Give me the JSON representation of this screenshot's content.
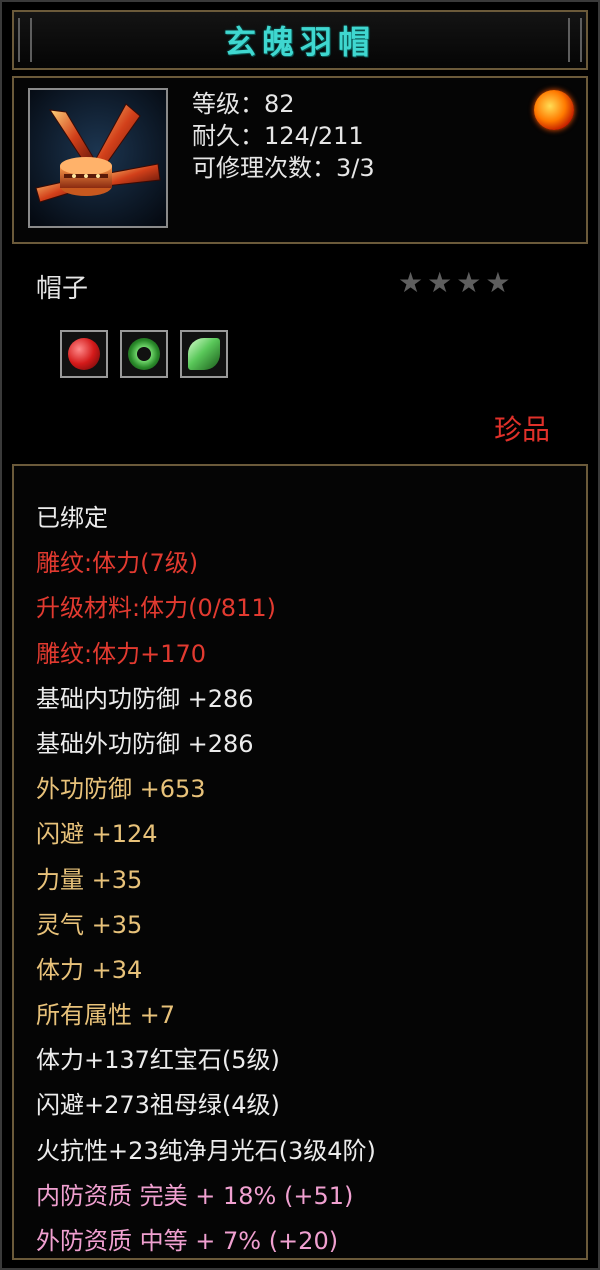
{
  "item": {
    "name": "玄魄羽帽",
    "stats": {
      "level": "等级：82",
      "durability": "耐久：124/211",
      "repairs": "可修理次数：3/3"
    },
    "type": "帽子",
    "stars": {
      "filled": 0,
      "total": 4
    },
    "quality": "珍品",
    "gems": [
      "red-gem-icon",
      "green-ring-gem-icon",
      "green-leaf-gem-icon"
    ]
  },
  "attributes": [
    {
      "text": "已绑定",
      "color": "white"
    },
    {
      "text": "雕纹:体力(7级)",
      "color": "red"
    },
    {
      "text": "升级材料:体力(0/811)",
      "color": "red"
    },
    {
      "text": "雕纹:体力+170",
      "color": "red"
    },
    {
      "text": "基础内功防御 +286",
      "color": "white"
    },
    {
      "text": "基础外功防御 +286",
      "color": "white"
    },
    {
      "text": "外功防御 +653",
      "color": "gold"
    },
    {
      "text": "闪避 +124",
      "color": "gold"
    },
    {
      "text": "力量 +35",
      "color": "gold"
    },
    {
      "text": "灵气 +35",
      "color": "gold"
    },
    {
      "text": "体力 +34",
      "color": "gold"
    },
    {
      "text": "所有属性 +7",
      "color": "gold"
    },
    {
      "text": "体力+137红宝石(5级)",
      "color": "white"
    },
    {
      "text": "闪避+273祖母绿(4级)",
      "color": "white"
    },
    {
      "text": "火抗性+23纯净月光石(3级4阶)",
      "color": "white"
    },
    {
      "text": "内防资质 完美 + 18% (+51)",
      "color": "pink"
    },
    {
      "text": "外防资质 中等 + 7% (+20)",
      "color": "pink"
    }
  ],
  "colors": {
    "title": "#3fd7d0",
    "white": "#ececec",
    "red": "#e23a30",
    "gold": "#e8c27a",
    "pink": "#f0a0d0",
    "border": "#6b5a3a"
  }
}
